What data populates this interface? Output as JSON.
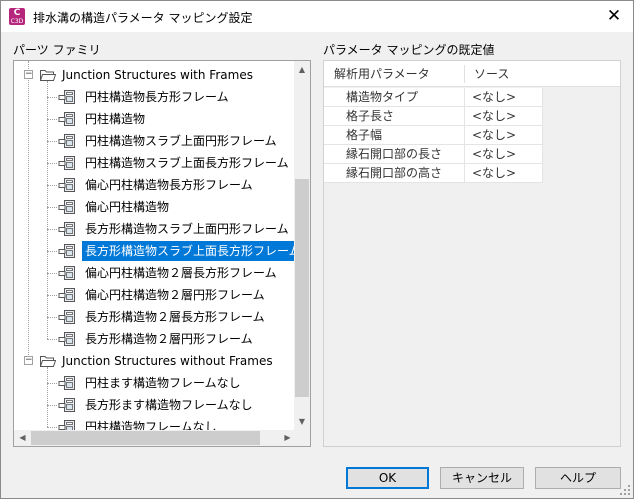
{
  "window": {
    "title": "排水溝の構造パラメータ マッピング設定",
    "app_icon_letter": "C",
    "app_icon_sub": "C3D",
    "close_glyph": "✕"
  },
  "left_panel": {
    "label": "パーツ ファミリ",
    "groups": [
      {
        "label": "Junction Structures with Frames",
        "expanded": true,
        "items": [
          {
            "label": "円柱構造物長方形フレーム",
            "selected": false
          },
          {
            "label": "円柱構造物",
            "selected": false
          },
          {
            "label": "円柱構造物スラブ上面円形フレーム",
            "selected": false
          },
          {
            "label": "円柱構造物スラブ上面長方形フレーム",
            "selected": false
          },
          {
            "label": "偏心円柱構造物長方形フレーム",
            "selected": false
          },
          {
            "label": "偏心円柱構造物",
            "selected": false
          },
          {
            "label": "長方形構造物スラブ上面円形フレーム",
            "selected": false
          },
          {
            "label": "長方形構造物スラブ上面長方形フレーム",
            "selected": true
          },
          {
            "label": "偏心円柱構造物２層長方形フレーム",
            "selected": false
          },
          {
            "label": "偏心円柱構造物２層円形フレーム",
            "selected": false
          },
          {
            "label": "長方形構造物２層長方形フレーム",
            "selected": false
          },
          {
            "label": "長方形構造物２層円形フレーム",
            "selected": false
          }
        ]
      },
      {
        "label": "Junction Structures without Frames",
        "expanded": true,
        "items": [
          {
            "label": "円柱ます構造物フレームなし",
            "selected": false
          },
          {
            "label": "長方形ます構造物フレームなし",
            "selected": false
          },
          {
            "label": "円柱構造物フレームなし",
            "selected": false
          }
        ]
      }
    ],
    "scroll_up_glyph": "▲",
    "scroll_down_glyph": "▼",
    "scroll_left_glyph": "◀",
    "scroll_right_glyph": "▶",
    "collapse_glyph": "−"
  },
  "right_panel": {
    "label": "パラメータ マッピングの既定値",
    "columns": [
      "解析用パラメータ",
      "ソース"
    ],
    "rows": [
      {
        "param": "構造物タイプ",
        "source": "<なし>"
      },
      {
        "param": "格子長さ",
        "source": "<なし>"
      },
      {
        "param": "格子幅",
        "source": "<なし>"
      },
      {
        "param": "縁石開口部の長さ",
        "source": "<なし>"
      },
      {
        "param": "縁石開口部の高さ",
        "source": "<なし>"
      }
    ]
  },
  "buttons": {
    "ok": "OK",
    "cancel": "キャンセル",
    "help": "ヘルプ"
  },
  "colors": {
    "selection": "#0078d7",
    "app_icon": "#b5267c",
    "dialog_bg": "#f0f0f0"
  }
}
